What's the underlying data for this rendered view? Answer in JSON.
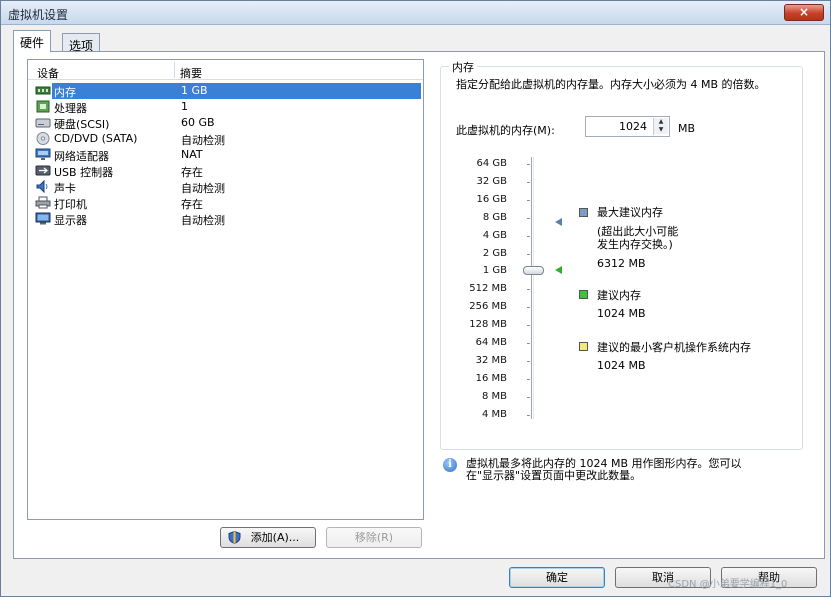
{
  "window": {
    "title": "虚拟机设置",
    "close_label": "×"
  },
  "tabs": [
    {
      "label": "硬件"
    },
    {
      "label": "选项"
    }
  ],
  "device_list": {
    "headers": {
      "device": "设备",
      "summary": "摘要"
    },
    "rows": [
      {
        "name": "内存",
        "summary": "1 GB",
        "icon": "memory-icon",
        "selected": true
      },
      {
        "name": "处理器",
        "summary": "1",
        "icon": "processor-icon"
      },
      {
        "name": "硬盘(SCSI)",
        "summary": "60 GB",
        "icon": "harddisk-icon"
      },
      {
        "name": "CD/DVD (SATA)",
        "summary": "自动检测",
        "icon": "cd-dvd-icon"
      },
      {
        "name": "网络适配器",
        "summary": "NAT",
        "icon": "network-adapter-icon"
      },
      {
        "name": "USB 控制器",
        "summary": "存在",
        "icon": "usb-icon"
      },
      {
        "name": "声卡",
        "summary": "自动检测",
        "icon": "sound-card-icon"
      },
      {
        "name": "打印机",
        "summary": "存在",
        "icon": "printer-icon"
      },
      {
        "name": "显示器",
        "summary": "自动检测",
        "icon": "display-icon"
      }
    ],
    "add_label": "添加(A)...",
    "remove_label": "移除(R)"
  },
  "memory": {
    "group_title": "内存",
    "description": "指定分配给此虚拟机的内存量。内存大小必须为 4 MB 的倍数。",
    "field_label": "此虚拟机的内存(M):",
    "value": "1024",
    "unit": "MB",
    "scale_ticks": [
      "64 GB",
      "32 GB",
      "16 GB",
      "8 GB",
      "4 GB",
      "2 GB",
      "1 GB",
      "512 MB",
      "256 MB",
      "128 MB",
      "64 MB",
      "32 MB",
      "16 MB",
      "8 MB",
      "4 MB"
    ],
    "legend": {
      "max": {
        "title": "最大建议内存",
        "note1": "(超出此大小可能",
        "note2": "发生内存交换。)",
        "value": "6312 MB",
        "color": "#7a9cc9"
      },
      "recommended": {
        "title": "建议内存",
        "value": "1024 MB",
        "color": "#3cc43c"
      },
      "min_guest": {
        "title": "建议的最小客户机操作系统内存",
        "value": "1024 MB",
        "color": "#f2ea7a"
      }
    },
    "info_line1": "虚拟机最多将此内存的 1024 MB 用作图形内存。您可以",
    "info_line2": "在\"显示器\"设置页面中更改此数量。"
  },
  "footer": {
    "ok": "确定",
    "cancel": "取消",
    "help": "帮助"
  },
  "watermark": "CSDN @小弟要学编程1_0"
}
